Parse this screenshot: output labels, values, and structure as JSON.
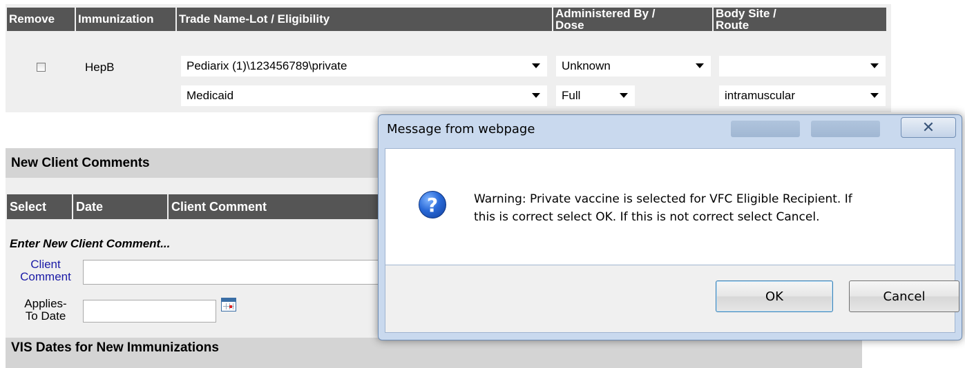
{
  "immunization_table": {
    "headers": {
      "remove": "Remove",
      "immunization": "Immunization",
      "trade_name": "Trade Name-Lot / Eligibility",
      "administered_line1": "Administered By /",
      "administered_line2": "Dose",
      "body_site_line1": "Body Site /",
      "body_site_line2": "Route"
    },
    "row": {
      "remove_checked": false,
      "immunization": "HepB",
      "trade_name_lot": "Pediarix (1)\\123456789\\private",
      "eligibility": "Medicaid",
      "administered_by": "Unknown",
      "dose": "Full",
      "body_site": "",
      "route": "intramuscular"
    }
  },
  "new_client_comments": {
    "title": "New Client Comments",
    "headers": {
      "select": "Select",
      "date": "Date",
      "client_comment": "Client Comment"
    },
    "enter_label": "Enter New Client Comment...",
    "client_comment_label_1": "Client",
    "client_comment_label_2": "Comment",
    "client_comment_value": "",
    "applies_to_label_1": "Applies-",
    "applies_to_label_2": "To Date",
    "applies_to_value": ""
  },
  "vis_section": {
    "title": "VIS Dates for New Immunizations"
  },
  "dialog": {
    "title": "Message from webpage",
    "close_glyph": "✕",
    "ghost_ok": "OK",
    "ghost_cancel": "Cancel",
    "icon_glyph": "?",
    "message_line1": "Warning: Private vaccine is selected for VFC Eligible Recipient. If",
    "message_line2": "this is correct select OK. If this is not correct select Cancel.",
    "ok_label": "OK",
    "cancel_label": "Cancel"
  },
  "colors": {
    "header_bg": "#555555",
    "section_bg": "#d4d4d4",
    "panel_bg": "#efefef",
    "dialog_frame": "#c9d9ee",
    "label_blue": "#1a1aa6"
  }
}
